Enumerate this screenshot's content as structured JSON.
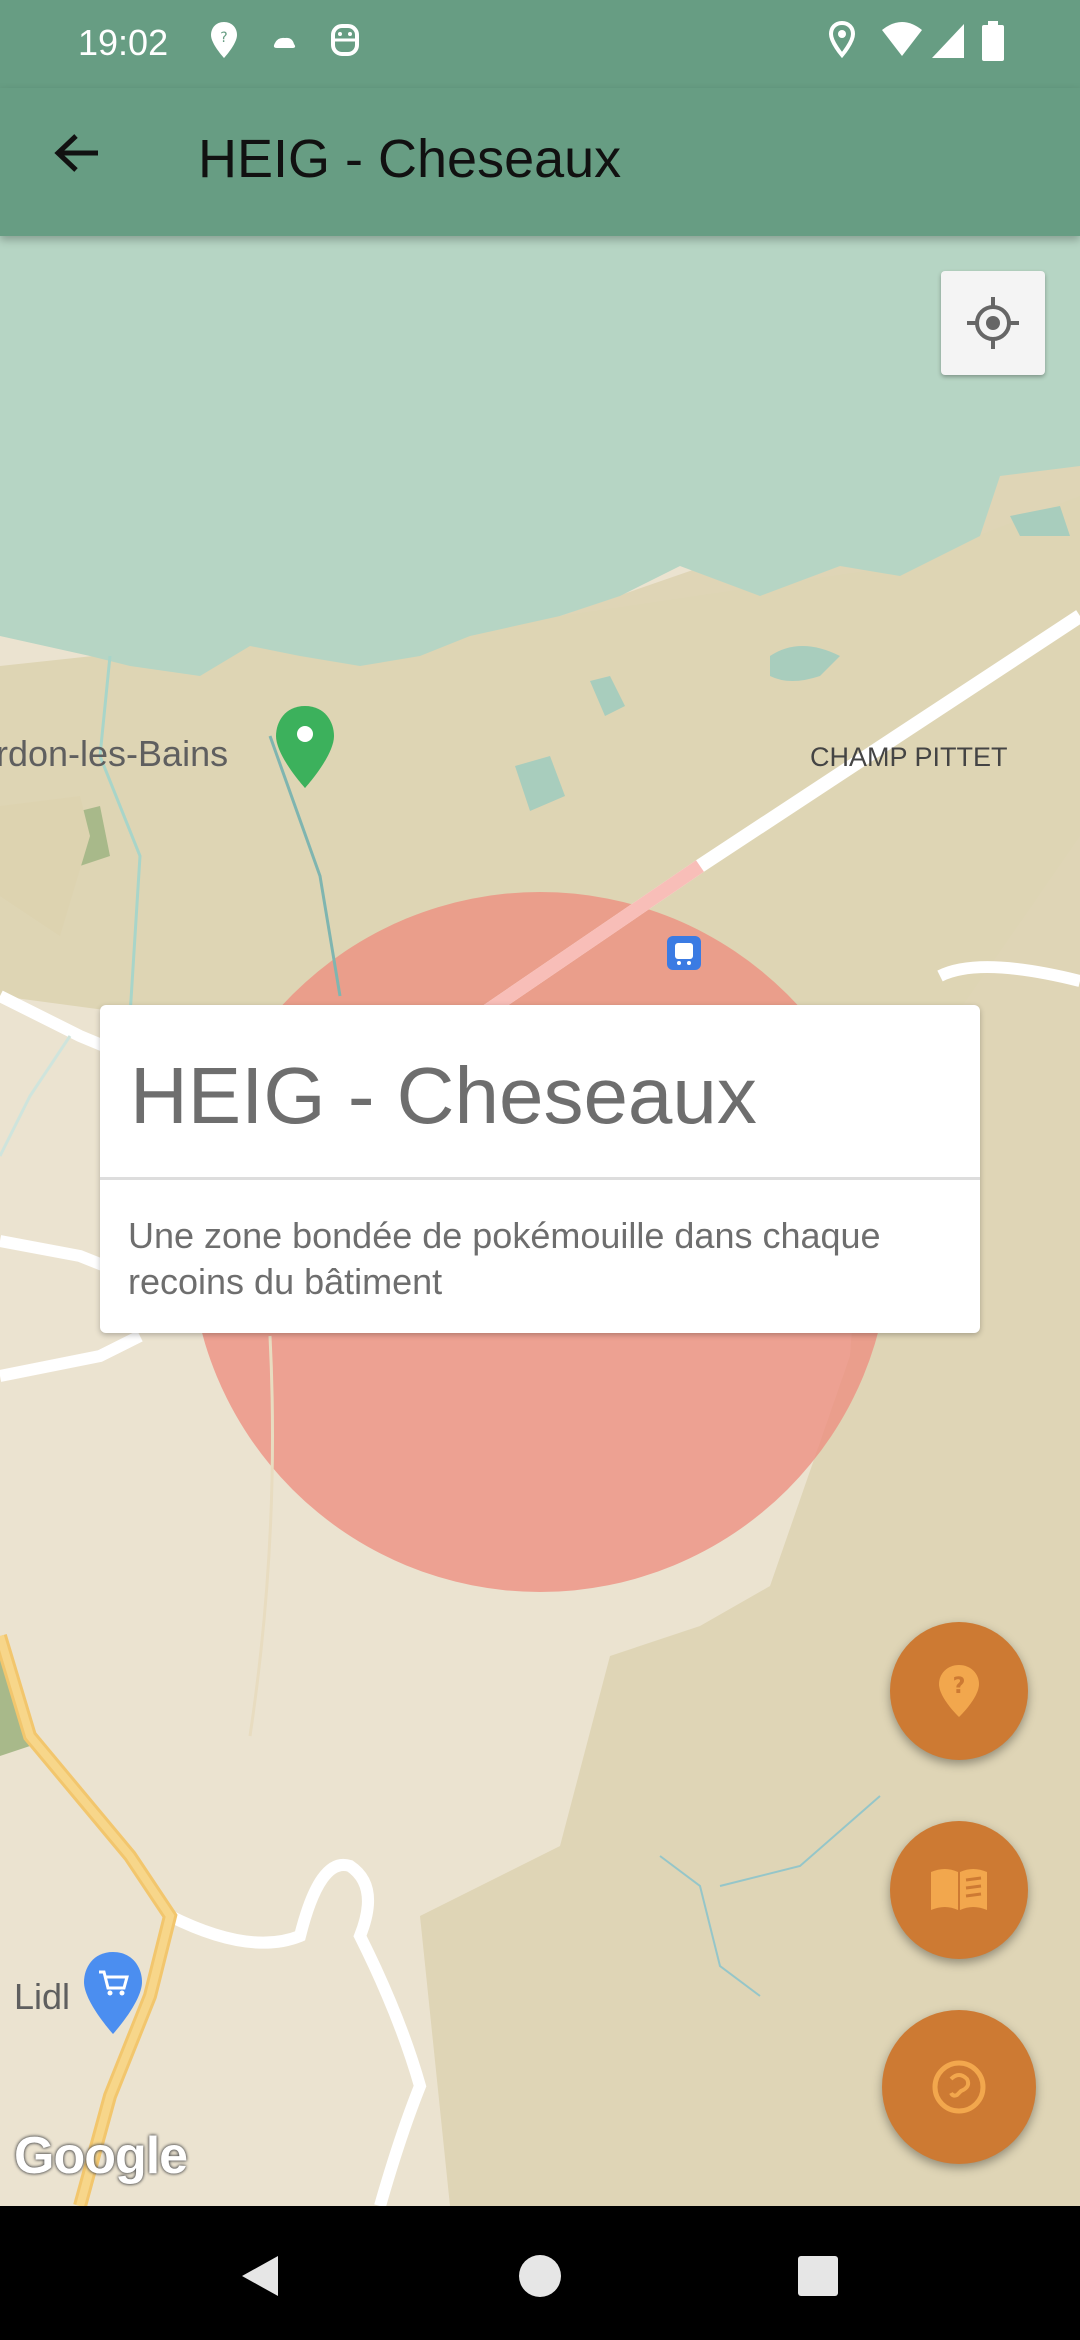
{
  "status_bar": {
    "time": "19:02",
    "icons_left": [
      "location-pin-icon",
      "cloud-icon",
      "android-icon"
    ],
    "icons_right": [
      "location-icon",
      "wifi-icon",
      "signal-icon",
      "battery-icon"
    ]
  },
  "app_bar": {
    "title": "HEIG - Cheseaux",
    "back_icon": "arrow-back-icon"
  },
  "map": {
    "labels": {
      "town": "rdon-les-Bains",
      "district": "CHAMP PITTET",
      "store": "Lidl"
    },
    "zone_color": "#ee8b7e",
    "google_logo": "Google"
  },
  "info_card": {
    "title": "HEIG - Cheseaux",
    "description": "Une zone bondée de pokémouille dans chaque recoins du bâtiment"
  },
  "fabs": [
    {
      "icon": "location-help-icon"
    },
    {
      "icon": "book-icon"
    },
    {
      "icon": "catch-icon"
    }
  ],
  "colors": {
    "accent": "#679d83",
    "fab": "#cd7a33",
    "water": "#b6d5c4"
  }
}
